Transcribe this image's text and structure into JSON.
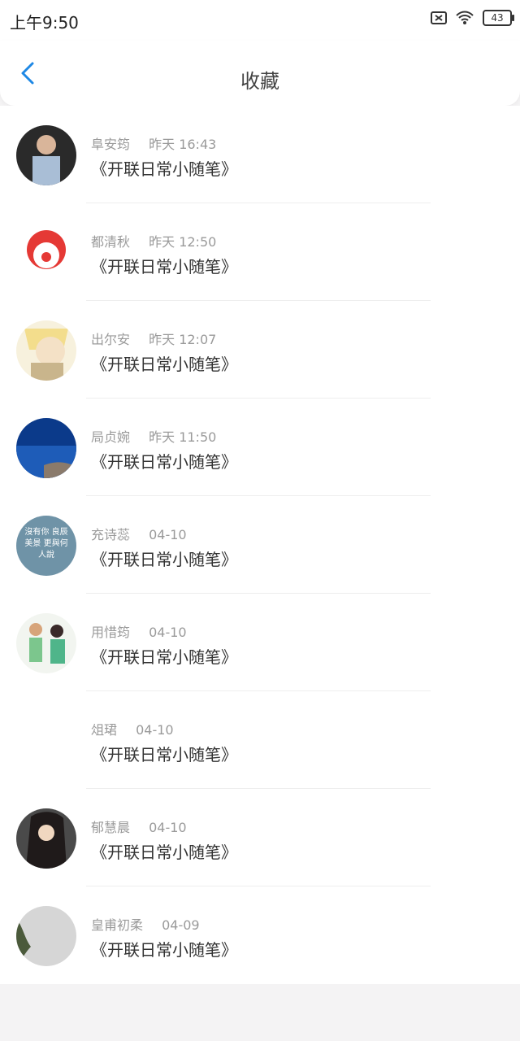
{
  "status": {
    "time": "上午9:50",
    "battery": "43"
  },
  "header": {
    "title": "收藏"
  },
  "items": [
    {
      "name": "阜安筠",
      "time": "昨天 16:43",
      "text": "《开联日常小随笔》"
    },
    {
      "name": "都清秋",
      "time": "昨天 12:50",
      "text": "《开联日常小随笔》"
    },
    {
      "name": "出尔安",
      "time": "昨天 12:07",
      "text": "《开联日常小随笔》"
    },
    {
      "name": "局贞婉",
      "time": "昨天 11:50",
      "text": "《开联日常小随笔》"
    },
    {
      "name": "充诗蕊",
      "time": "04-10",
      "text": "《开联日常小随笔》",
      "avatar_text": "沒有你 良辰美景 更與何人說"
    },
    {
      "name": "用惜筠",
      "time": "04-10",
      "text": "《开联日常小随笔》"
    },
    {
      "name": "俎珺",
      "time": "04-10",
      "text": "《开联日常小随笔》"
    },
    {
      "name": "郁慧晨",
      "time": "04-10",
      "text": "《开联日常小随笔》"
    },
    {
      "name": "皇甫初柔",
      "time": "04-09",
      "text": "《开联日常小随笔》"
    }
  ],
  "colors": {
    "accent": "#1e88e5",
    "title": "#444444",
    "meta": "#9a9a9a",
    "text": "#333333"
  }
}
